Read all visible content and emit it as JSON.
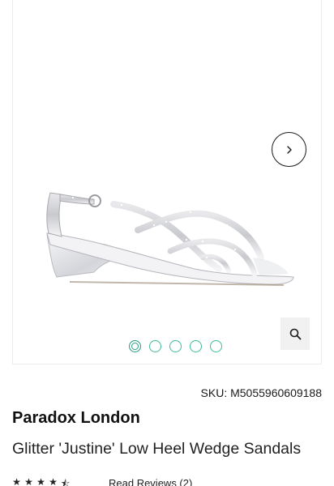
{
  "product": {
    "sku_label": "SKU: M5055960609188",
    "brand": "Paradox London",
    "title": "Glitter 'Justine' Low Heel Wedge Sandals",
    "rating_value": 4.5,
    "rating_max": 5,
    "reviews_link": "Read Reviews (2)"
  },
  "gallery": {
    "image_count": 5,
    "active_index": 0,
    "next_icon": "chevron-right-icon",
    "zoom_icon": "magnifier-icon"
  },
  "colors": {
    "dot_accent": "#3dbb9b",
    "text": "#1a1a1a"
  }
}
